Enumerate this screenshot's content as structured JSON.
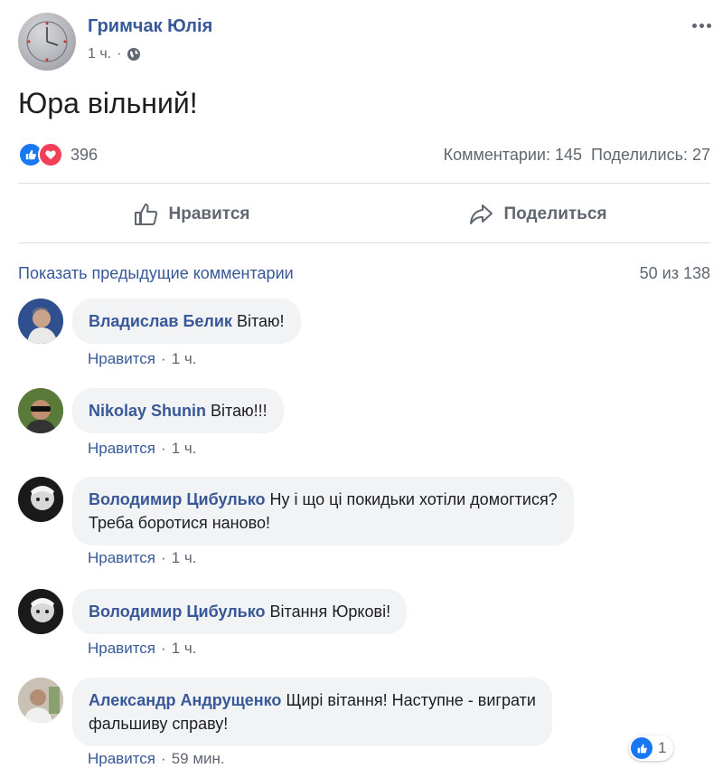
{
  "post": {
    "author": "Гримчак Юлія",
    "time": "1 ч.",
    "separator": "·",
    "text": "Юра вільний!",
    "reactions_count": "396",
    "comments_stat": "Комментарии: 145",
    "shares_stat": "Поделились: 27"
  },
  "actions": {
    "like_label": "Нравится",
    "share_label": "Поделиться"
  },
  "comments_header": {
    "prev_label": "Показать предыдущие комментарии",
    "count": "50 из 138"
  },
  "comments": [
    {
      "author": "Владислав Белик",
      "text": "Вітаю!",
      "like_label": "Нравится",
      "sep": "·",
      "time": "1 ч."
    },
    {
      "author": "Nikolay Shunin",
      "text": "Вітаю!!!",
      "like_label": "Нравится",
      "sep": "·",
      "time": "1 ч."
    },
    {
      "author": "Володимир Цибулько",
      "text": "Ну і що ці покидьки хотіли домогтися?",
      "text2": "Треба боротися наново!",
      "like_label": "Нравится",
      "sep": "·",
      "time": "1 ч."
    },
    {
      "author": "Володимир Цибулько",
      "text": "Вітання Юркові!",
      "like_label": "Нравится",
      "sep": "·",
      "time": "1 ч."
    },
    {
      "author": "Александр Андрущенко",
      "text": "Щирі вітання! Наступне - виграти",
      "text2": "фальшиву справу!",
      "like_label": "Нравится",
      "sep": "·",
      "time": "59 мин.",
      "reaction_count": "1"
    }
  ],
  "colors": {
    "link": "#385898",
    "secondary": "#606770",
    "like_blue": "#1877f2",
    "love_red": "#f33e58",
    "bubble": "#f2f3f5"
  },
  "icons": [
    "more-options-icon",
    "globe-icon",
    "like-reaction-icon",
    "love-reaction-icon",
    "thumbs-up-icon",
    "share-arrow-icon"
  ]
}
